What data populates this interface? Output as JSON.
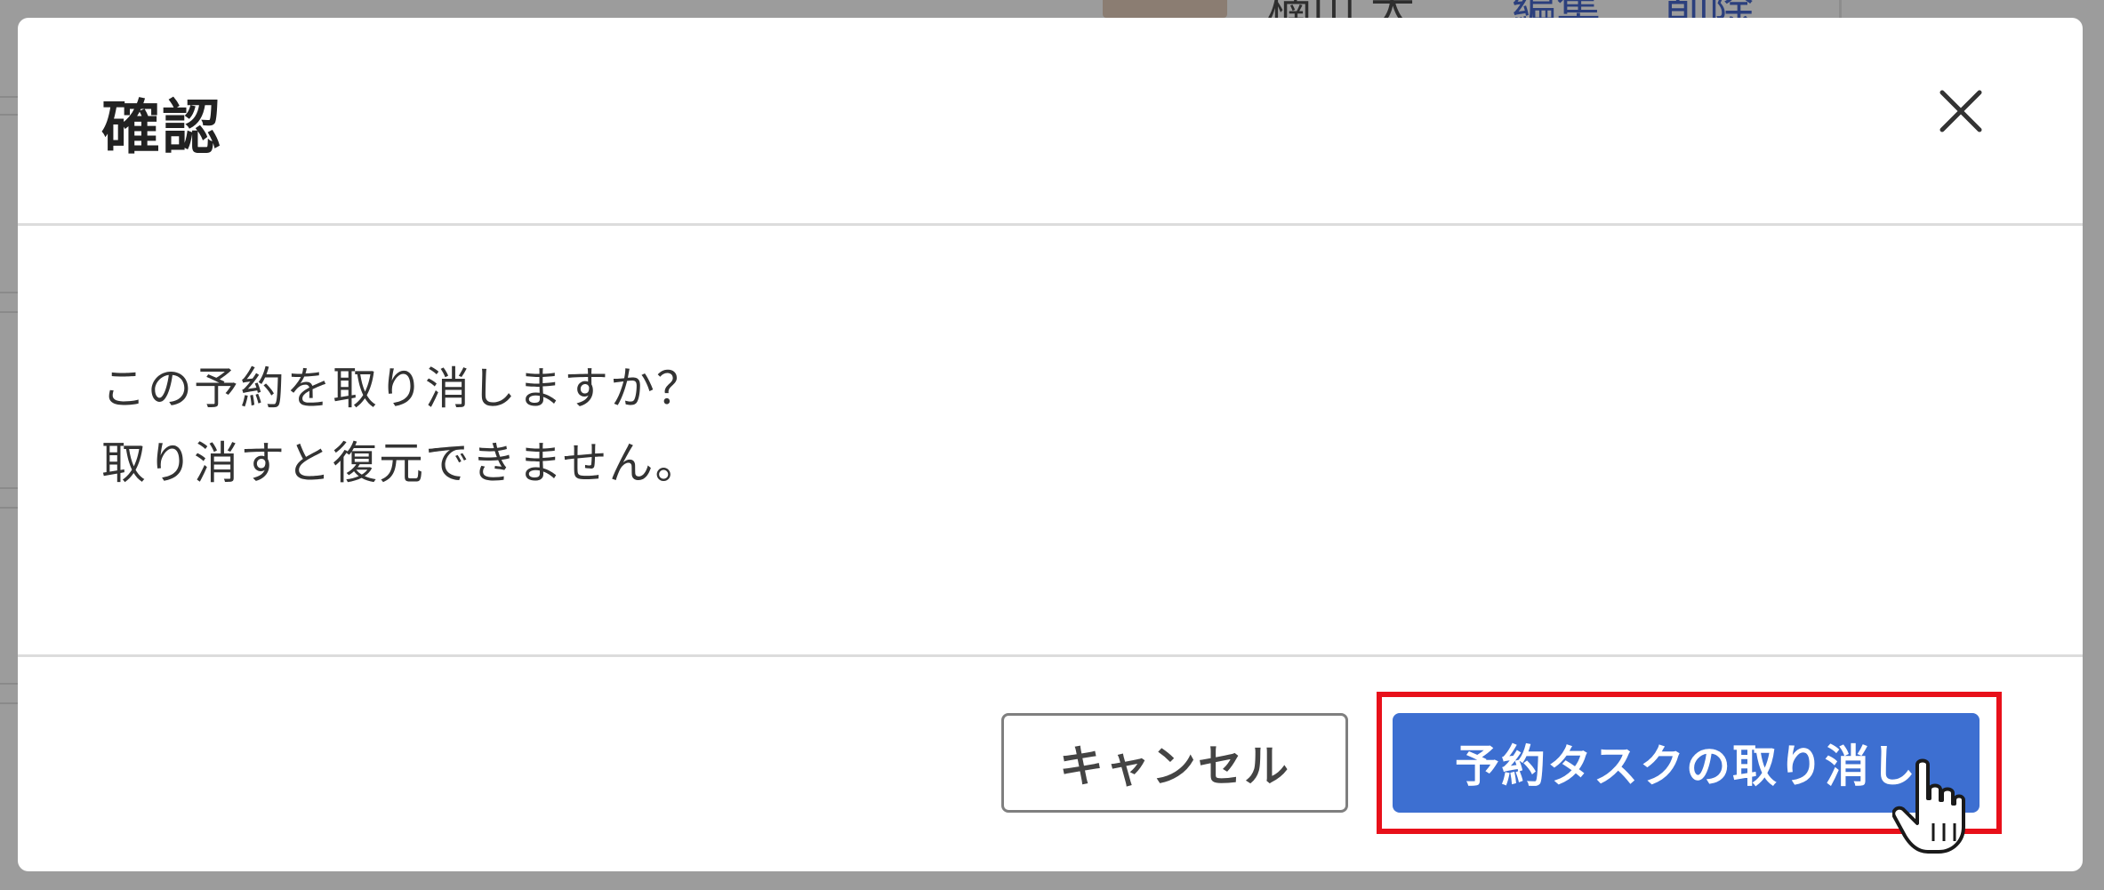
{
  "background": {
    "name_partial": "楠山 太",
    "edit_link": "編集",
    "delete_link": "削除"
  },
  "modal": {
    "title": "確認",
    "close_icon": "close-icon",
    "message_lines": [
      "この予約を取り消しますか？",
      "取り消すと復元できません。"
    ],
    "buttons": {
      "cancel_label": "キャンセル",
      "confirm_label": "予約タスクの取り消し"
    }
  },
  "colors": {
    "primary": "#3d6fd1",
    "highlight": "#e8101a",
    "overlay": "#9c9c9c"
  },
  "pointer_icon": "hand-pointer-icon"
}
